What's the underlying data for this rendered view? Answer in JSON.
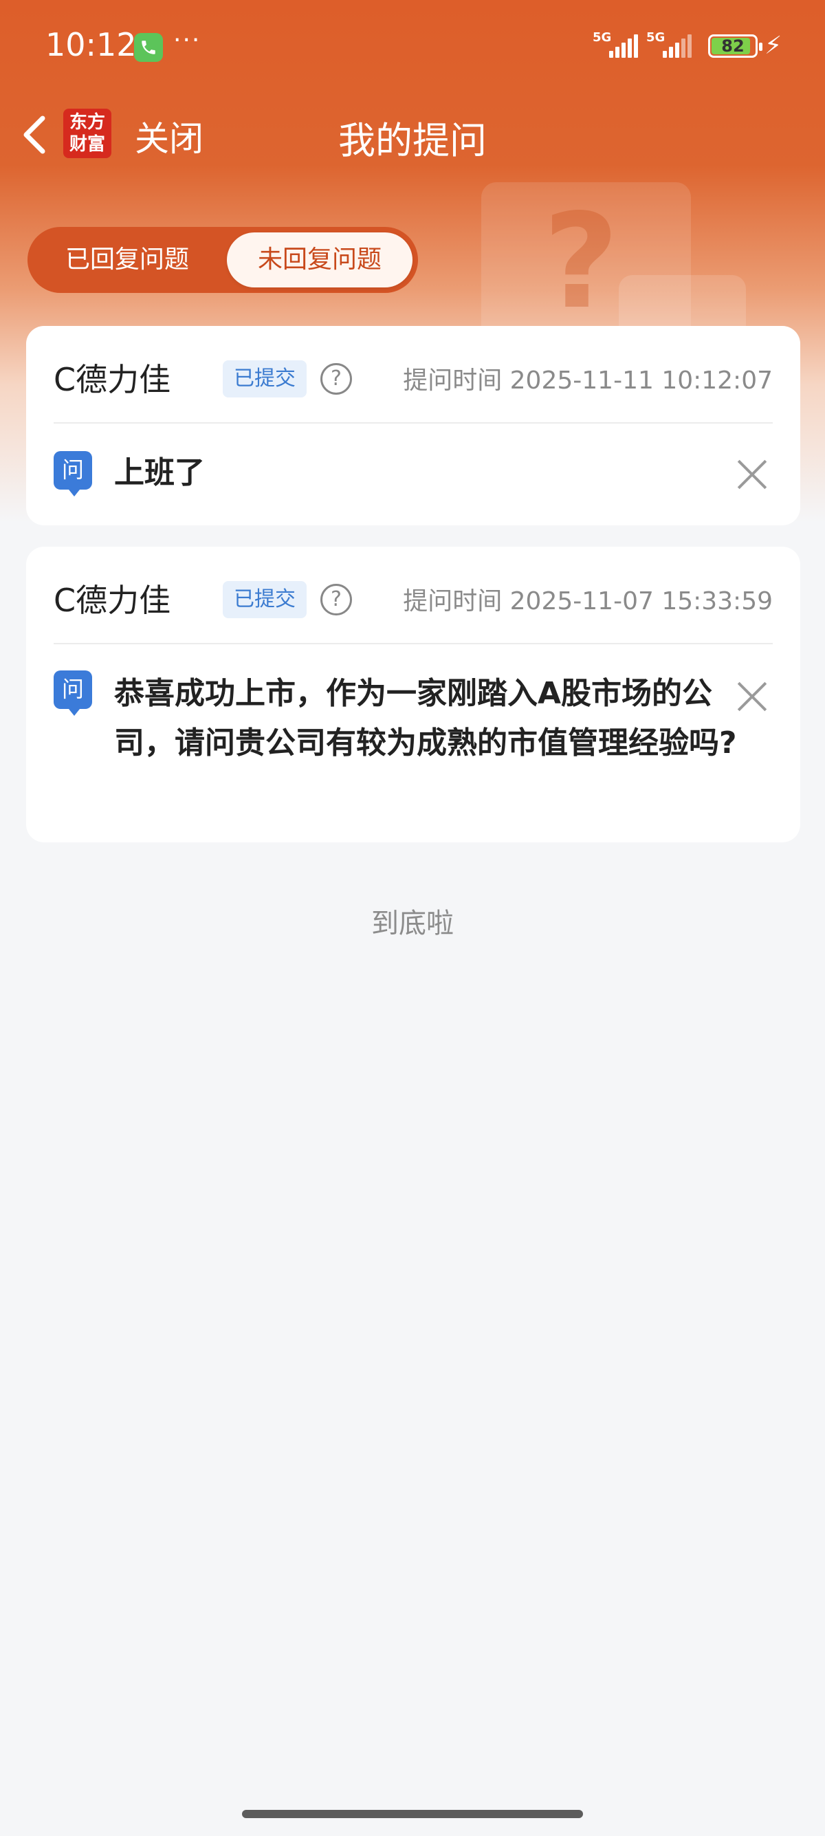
{
  "status_bar": {
    "time": "10:12",
    "more": "···",
    "signal1_label": "5G",
    "signal2_label": "5G",
    "battery": "82",
    "icons": [
      "phone-call-icon",
      "signal-icon",
      "battery-icon",
      "charging-icon"
    ]
  },
  "nav": {
    "logo_line1": "东方",
    "logo_line2": "财富",
    "close_label": "关闭",
    "title": "我的提问"
  },
  "tabs": [
    {
      "label": "已回复问题",
      "selected": false
    },
    {
      "label": "未回复问题",
      "selected": true
    }
  ],
  "questions": [
    {
      "company": "C德力佳",
      "status": "已提交",
      "time_label": "提问时间",
      "time": "2025-11-11 10:12:07",
      "icon": "问",
      "text": "上班了"
    },
    {
      "company": "C德力佳",
      "status": "已提交",
      "time_label": "提问时间",
      "time": "2025-11-07 15:33:59",
      "icon": "问",
      "text": "恭喜成功上市，作为一家刚踏入A股市场的公司，请问贵公司有较为成熟的市值管理经验吗?"
    }
  ],
  "footer": {
    "end_text": "到底啦"
  },
  "colors": {
    "brand": "#dd5e2a",
    "badge_blue": "#3b7bd0",
    "question_icon": "#3b7bd9"
  }
}
